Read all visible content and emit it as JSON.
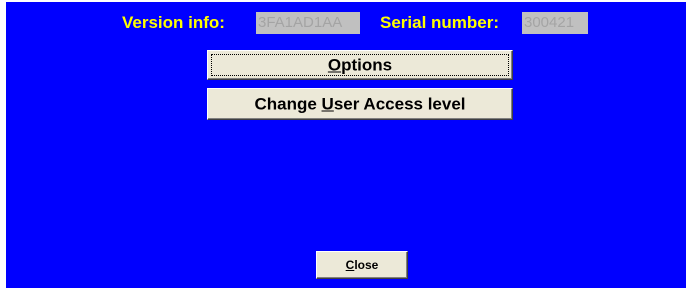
{
  "info": {
    "version_label": "Version info:",
    "version_value": "3FA1AD1AA",
    "serial_label": "Serial number:",
    "serial_value": "300421"
  },
  "buttons": {
    "options": {
      "pre": "",
      "mnemonic": "O",
      "post": "ptions"
    },
    "change_access": {
      "pre": "Change ",
      "mnemonic": "U",
      "post": "ser Access level"
    },
    "close": {
      "pre": "",
      "mnemonic": "C",
      "post": "lose"
    }
  },
  "colors": {
    "panel_background": "#0000ff",
    "label_text": "#ffff00",
    "field_background": "#c0c0c0",
    "field_text": "#a4a4a4",
    "button_face": "#ece9d8"
  }
}
